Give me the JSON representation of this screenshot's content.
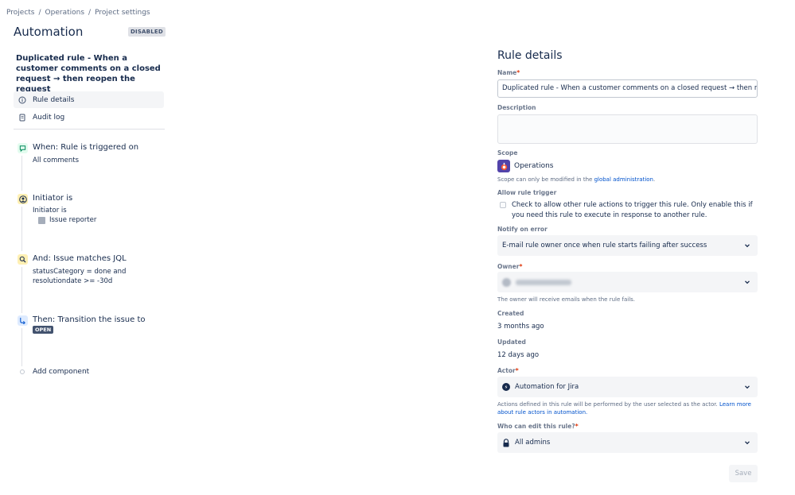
{
  "breadcrumb": {
    "items": [
      "Projects",
      "Operations",
      "Project settings"
    ]
  },
  "header": {
    "title": "Automation",
    "status": "DISABLED"
  },
  "rule": {
    "title": "Duplicated rule - When a customer comments on a closed request → then reopen the request"
  },
  "nav": [
    {
      "label": "Rule details",
      "icon": "info-icon",
      "active": true
    },
    {
      "label": "Audit log",
      "icon": "document-icon",
      "active": false
    }
  ],
  "components": {
    "trigger": {
      "title": "When: Rule is triggered on",
      "sub": "All comments",
      "icon": "comment-icon"
    },
    "initiator": {
      "title": "Initiator is",
      "sub": "Initiator is",
      "value": "Issue reporter",
      "icon": "user-circle-icon"
    },
    "condition": {
      "title": "And: Issue matches JQL",
      "line1": "statusCategory = done and",
      "line2": "resolutiondate >= -30d",
      "icon": "search-icon"
    },
    "action": {
      "title": "Then: Transition the issue to",
      "status": "OPEN",
      "icon": "transition-icon"
    },
    "add": "Add component"
  },
  "details": {
    "title": "Rule details",
    "name_label": "Name",
    "name_value": "Duplicated rule - When a customer comments on a closed request → then reopen the request",
    "description_label": "Description",
    "description_value": "",
    "scope_label": "Scope",
    "scope_value": "Operations",
    "scope_helper_prefix": "Scope can only be modified in the ",
    "scope_helper_link": "global administration",
    "scope_helper_suffix": ".",
    "allow_trigger_label": "Allow rule trigger",
    "allow_trigger_text": "Check to allow other rule actions to trigger this rule. Only enable this if you need this rule to execute in response to another rule.",
    "allow_trigger_checked": false,
    "notify_label": "Notify on error",
    "notify_value": "E-mail rule owner once when rule starts failing after success",
    "owner_label": "Owner",
    "owner_helper": "The owner will receive emails when the rule fails.",
    "created_label": "Created",
    "created_value": "3 months ago",
    "updated_label": "Updated",
    "updated_value": "12 days ago",
    "actor_label": "Actor",
    "actor_value": "Automation for Jira",
    "actor_helper_prefix": "Actions defined in this rule will be performed by the user selected as the actor. ",
    "actor_helper_link": "Learn more about rule actors in automation.",
    "editors_label": "Who can edit this rule?",
    "editors_value": "All admins",
    "save_label": "Save"
  },
  "colors": {
    "trigger_icon_bg": "#e3fcef",
    "initiator_icon_bg": "#fff0b3",
    "condition_icon_bg": "#fff0b3",
    "action_icon_bg": "#deebff",
    "link": "#0052cc",
    "required": "#de350b"
  }
}
